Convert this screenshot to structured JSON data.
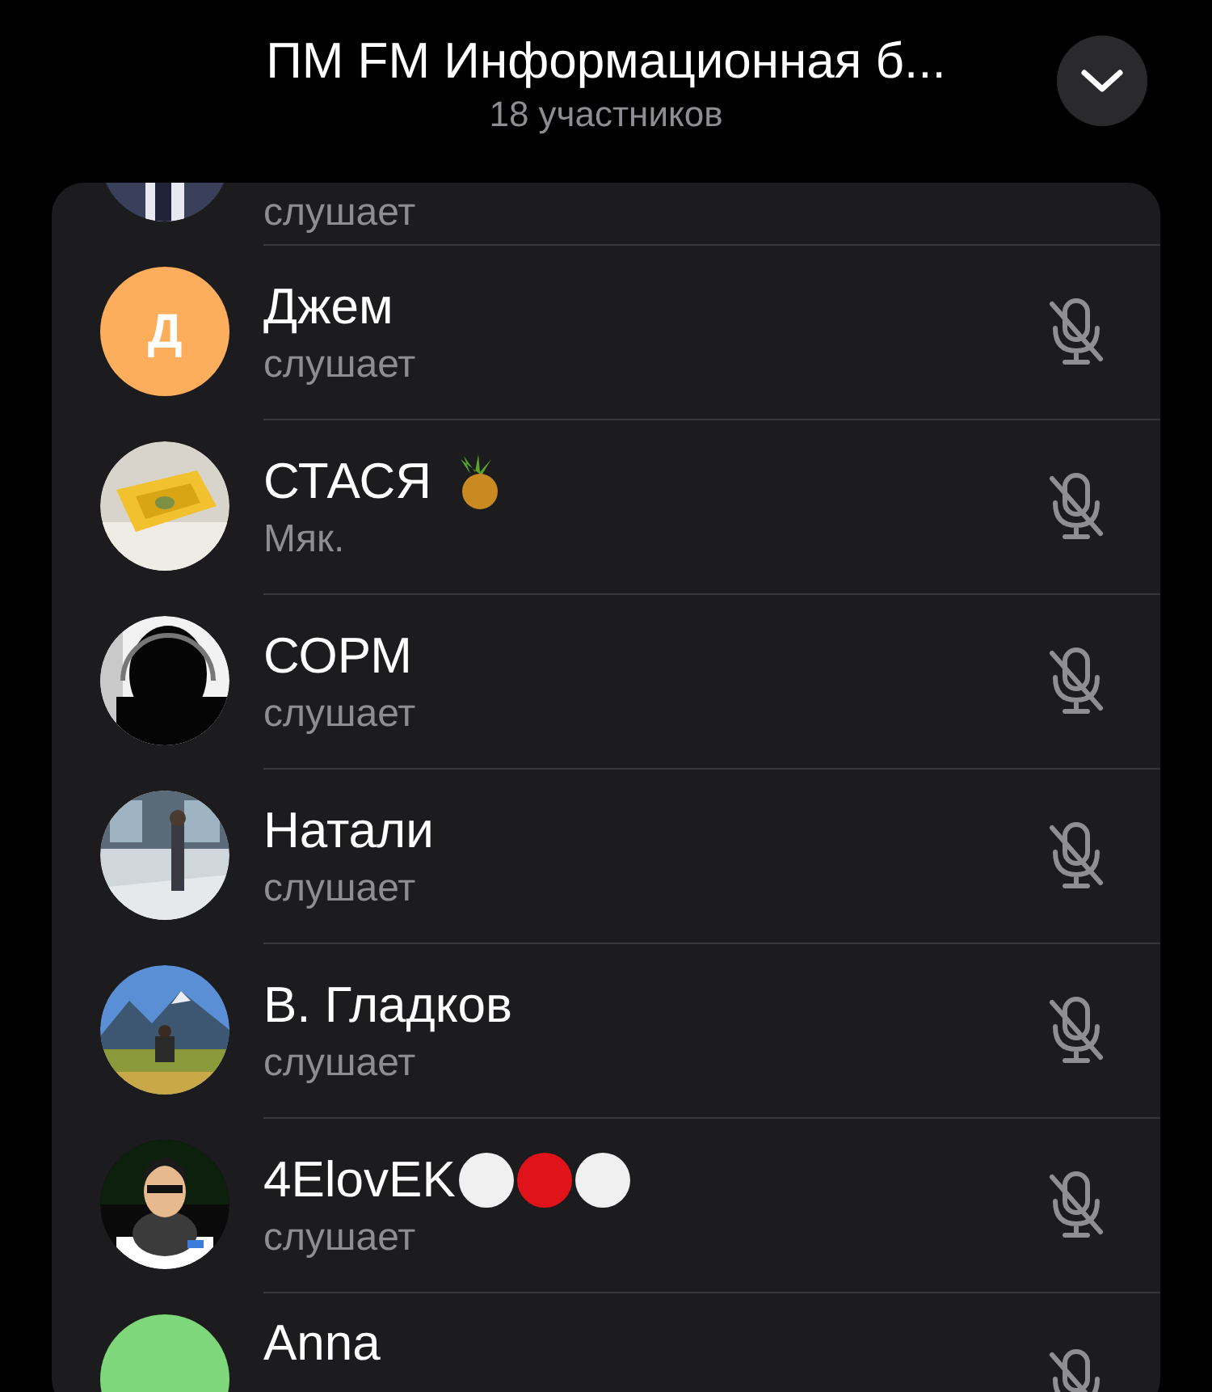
{
  "header": {
    "title": "ПМ FM Информационная б...",
    "subtitle": "18 участников"
  },
  "participants": [
    {
      "status": "слушает"
    },
    {
      "name": "Джем",
      "status": "слушает",
      "avatar": {
        "kind": "letter",
        "letter": "Д",
        "color": "#fdae5d"
      },
      "muted": true
    },
    {
      "name": "СТАСЯ",
      "status": "Мяк.",
      "muted": true,
      "emoji": [
        {
          "kind": "pineapple"
        }
      ]
    },
    {
      "name": "СОРМ",
      "status": "слушает",
      "muted": true
    },
    {
      "name": "Натали",
      "status": "слушает",
      "muted": true
    },
    {
      "name": "В. Гладков",
      "status": "слушает",
      "muted": true
    },
    {
      "name": "4ElovEK",
      "status": "слушает",
      "muted": true,
      "emoji": [
        {
          "kind": "circle",
          "color": "#f0f0f0"
        },
        {
          "kind": "circle",
          "color": "#e0131a"
        },
        {
          "kind": "circle",
          "color": "#f0f0f0"
        }
      ]
    },
    {
      "name": "Anna",
      "avatar": {
        "kind": "color",
        "color": "#7fd77c"
      },
      "muted": true
    }
  ]
}
